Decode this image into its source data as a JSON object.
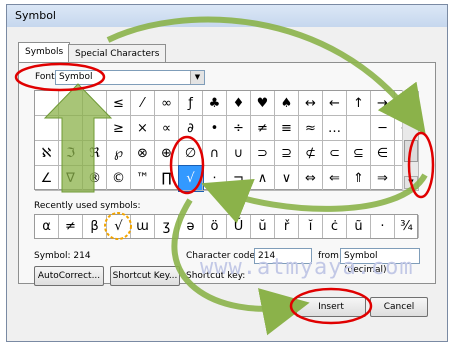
{
  "window": {
    "title": "Symbol"
  },
  "tabs": [
    {
      "label": "Symbols",
      "active": true
    },
    {
      "label": "Special Characters",
      "active": false
    }
  ],
  "font": {
    "label": "Font:",
    "value": "Symbol"
  },
  "grid_symbols": [
    [
      "",
      "",
      "",
      "≤",
      "⁄",
      "∞",
      "ƒ",
      "♣",
      "♦",
      "♥",
      "♠",
      "↔",
      "←",
      "↑",
      "→",
      "↓"
    ],
    [
      "",
      "",
      "",
      "≥",
      "×",
      "∝",
      "∂",
      "•",
      "÷",
      "≠",
      "≡",
      "≈",
      "…",
      "",
      "─",
      "↵"
    ],
    [
      "ℵ",
      "ℑ",
      "ℜ",
      "℘",
      "⊗",
      "⊕",
      "∅",
      "∩",
      "∪",
      "⊃",
      "⊇",
      "⊄",
      "⊂",
      "⊆",
      "∈",
      "∉"
    ],
    [
      "∠",
      "∇",
      "®",
      "©",
      "™",
      "∏",
      "√",
      "⋅",
      "¬",
      "∧",
      "∨",
      "⇔",
      "⇐",
      "⇑",
      "⇒",
      "⇓"
    ]
  ],
  "selected_symbol": "√",
  "recent": {
    "label": "Recently used symbols:",
    "symbols": [
      "α",
      "≠",
      "β",
      "√",
      "ɯ",
      "ʒ",
      "ə",
      "ö",
      "Ŭ",
      "ŭ",
      "ř",
      "ĭ",
      "ċ",
      "ũ",
      "·",
      "¾"
    ]
  },
  "status": {
    "symbol_info": "Symbol: 214"
  },
  "character_code": {
    "label": "Character code:",
    "value": "214"
  },
  "from": {
    "label": "from:",
    "value": "Symbol (decimal)"
  },
  "shortcut_key_label": "Shortcut key:",
  "buttons": {
    "autocorrect": "AutoCorrect...",
    "shortcut_key": "Shortcut Key...",
    "insert": "Insert",
    "cancel": "Cancel"
  },
  "watermark": "www.atmyaya.com",
  "colors": {
    "annotation_red": "#e00000",
    "arrow_green": "#8bb24a",
    "highlight_orange": "#f2a400",
    "selection_blue": "#3399ff"
  }
}
